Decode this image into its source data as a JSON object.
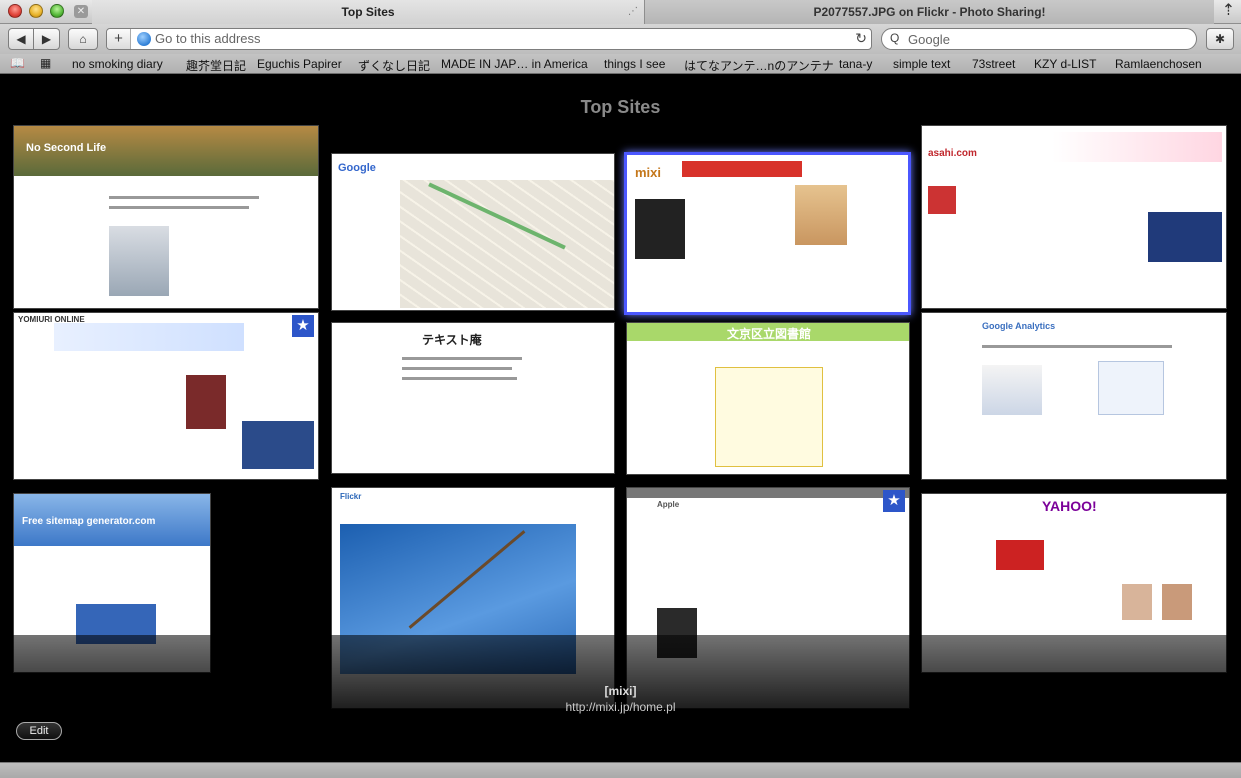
{
  "window": {
    "active_tab": "Top Sites",
    "inactive_tab": "P2077557.JPG on Flickr - Photo Sharing!",
    "tab_close": "✕",
    "new_tab": "⇡"
  },
  "toolbar": {
    "back": "◀",
    "forward": "▶",
    "home": "⌂",
    "address_plus": "+",
    "address_placeholder": "Go to this address",
    "reload": "↻",
    "search_placeholder": "Google",
    "search_icon": "Q",
    "bug": "✱"
  },
  "bookmarks": {
    "icons": [
      "📖",
      "▦"
    ],
    "items": [
      "no smoking diary",
      "趣芥堂日記",
      "Eguchis Papirer",
      "ずくなし日記",
      "MADE IN JAP… in America",
      "things I see",
      "はてなアンテ…nのアンテナ",
      "tana-y",
      "simple text",
      "73street",
      "KZY d-LIST",
      "Ramlaenchosen"
    ]
  },
  "top_sites": {
    "title": "Top Sites",
    "thumbs": [
      {
        "label": "No Second Life",
        "accent": "#6b8a3c"
      },
      {
        "label": "Google",
        "accent": "#3366cc"
      },
      {
        "label": "mixi",
        "accent": "#d08a2a"
      },
      {
        "label": "asahi.com",
        "accent": "#c0272d"
      },
      {
        "label": "YOMIURI ONLINE",
        "accent": "#1f4fa8"
      },
      {
        "label": "テキスト庵",
        "accent": "#333333"
      },
      {
        "label": "文京区立図書館",
        "accent": "#7aa63a"
      },
      {
        "label": "Google Analytics",
        "accent": "#3a6fbf"
      },
      {
        "label": "Free sitemap generator.com",
        "accent": "#3d78c8"
      },
      {
        "label": "Flickr",
        "accent": "#2a66b8"
      },
      {
        "label": "Apple",
        "accent": "#555555"
      },
      {
        "label": "YAHOO!",
        "accent": "#7b0099"
      }
    ],
    "selected_name": "[mixi]",
    "selected_url": "http://mixi.jp/home.pl",
    "edit_label": "Edit"
  }
}
